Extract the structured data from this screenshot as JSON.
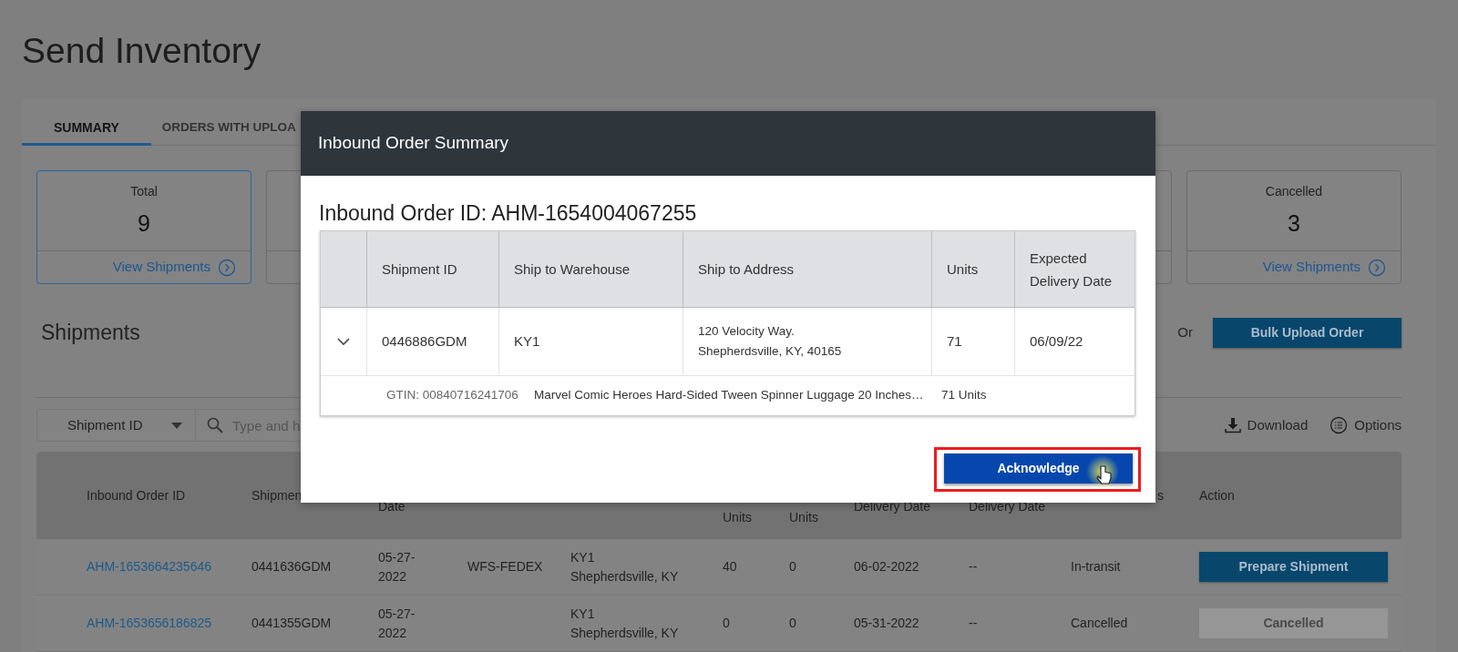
{
  "page_title": "Send Inventory",
  "tabs": [
    {
      "label": "SUMMARY",
      "selected": true
    },
    {
      "label": "ORDERS WITH UPLOA",
      "selected": false
    }
  ],
  "cards": [
    {
      "label": "Total",
      "count": "9",
      "link": "View Shipments",
      "selected": true
    },
    {
      "label": "Cancelled",
      "count": "3",
      "link": "View Shipments",
      "selected": false
    }
  ],
  "shipments": {
    "heading": "Shipments",
    "or_text": "Or",
    "bulk_button": "Bulk Upload Order"
  },
  "filter": {
    "select_value": "Shipment ID",
    "search_placeholder": "Type and h",
    "download": "Download",
    "options": "Options"
  },
  "table": {
    "columns": [
      "Inbound Order ID",
      "Shipmen",
      "Date",
      "Units",
      "Units",
      "Delivery Date",
      "Delivery Date",
      "s",
      "Action"
    ],
    "rows": [
      {
        "inbound_order_id": "AHM-1653664235646",
        "shipment_id": "0441636GDM",
        "date": "05-27-2022",
        "carrier": "WFS-FEDEX",
        "ship_to": [
          "KY1",
          "Shepherdsville, KY"
        ],
        "units_1": "40",
        "units_2": "0",
        "expected": "06-02-2022",
        "actual": "--",
        "status": "In-transit",
        "action": {
          "label": "Prepare Shipment",
          "disabled": false
        }
      },
      {
        "inbound_order_id": "AHM-1653656186825",
        "shipment_id": "0441355GDM",
        "date": "05-27-2022",
        "ship_to": [
          "KY1",
          "Shepherdsville, KY"
        ],
        "units_1": "0",
        "units_2": "0",
        "expected": "05-31-2022",
        "actual": "--",
        "status": "Cancelled",
        "action": {
          "label": "Cancelled",
          "disabled": true
        }
      }
    ]
  },
  "modal": {
    "title": "Inbound Order Summary",
    "order_heading": "Inbound Order ID: AHM-1654004067255",
    "columns": [
      "Shipment ID",
      "Ship to Warehouse",
      "Ship to Address",
      "Units",
      "Expected Delivery Date"
    ],
    "row": {
      "expanded": true,
      "shipment_id": "0446886GDM",
      "warehouse": "KY1",
      "address": [
        "120 Velocity Way.",
        "Shepherdsville, KY, 40165"
      ],
      "units": "71",
      "date": "06/09/22"
    },
    "detail": {
      "gtin": "GTIN: 00840716241706",
      "product": "Marvel Comic Heroes Hard-Sided Tween Spinner Luggage 20 Inches…",
      "units": "71 Units"
    },
    "button": "Acknowledge"
  }
}
